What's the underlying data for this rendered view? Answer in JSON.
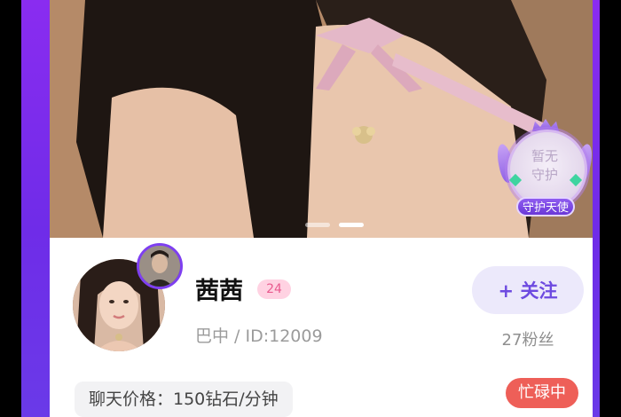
{
  "guardian": {
    "line1": "暂无",
    "line2": "守护",
    "badge": "守护天使"
  },
  "carousel": {
    "total": 2,
    "active": 2
  },
  "profile": {
    "name": "茜茜",
    "age": "24",
    "location_id": "巴中 / ID:12009",
    "follow_label": "+ 关注",
    "fans": "27粉丝",
    "price": "聊天价格：150钻石/分钟",
    "status": "忙碌中"
  },
  "colors": {
    "frame_purple": "#7b2cf0",
    "follow_bg": "#ece9fb",
    "follow_text": "#6d4ae0",
    "age_badge": "#ffd2e2",
    "status_red": "#ee5f58"
  }
}
